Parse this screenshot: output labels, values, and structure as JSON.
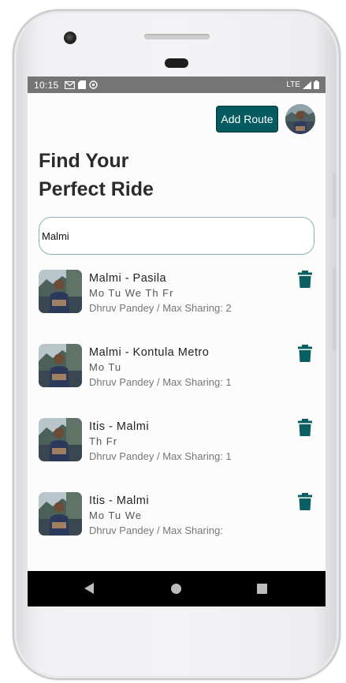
{
  "status_bar": {
    "time": "10:15",
    "icons": [
      "gmail-icon",
      "sd-card-icon",
      "sync-icon"
    ],
    "network": "LTE",
    "battery_icon": "battery-icon",
    "signal_icon": "signal-icon"
  },
  "header": {
    "add_route_label": "Add Route",
    "avatar_icon": "profile-avatar"
  },
  "title": {
    "line1": "Find Your",
    "line2": "Perfect Ride"
  },
  "search": {
    "value": "Malmi",
    "placeholder": ""
  },
  "rides": [
    {
      "route": "Malmi - Pasila",
      "days": "Mo Tu We Th Fr",
      "driver": "Dhruv Pandey / Max Sharing: 2"
    },
    {
      "route": "Malmi - Kontula Metro",
      "days": "Mo Tu",
      "driver": "Dhruv Pandey / Max Sharing: 1"
    },
    {
      "route": "Itis - Malmi",
      "days": "Th Fr",
      "driver": "Dhruv Pandey / Max Sharing: 1"
    },
    {
      "route": "Itis - Malmi",
      "days": "Mo Tu We",
      "driver": "Dhruv Pandey / Max Sharing:"
    }
  ],
  "colors": {
    "accent": "#055a5f",
    "delete_icon": "#0b5e61",
    "status_bar": "#757575",
    "nav_bar": "#000000"
  }
}
